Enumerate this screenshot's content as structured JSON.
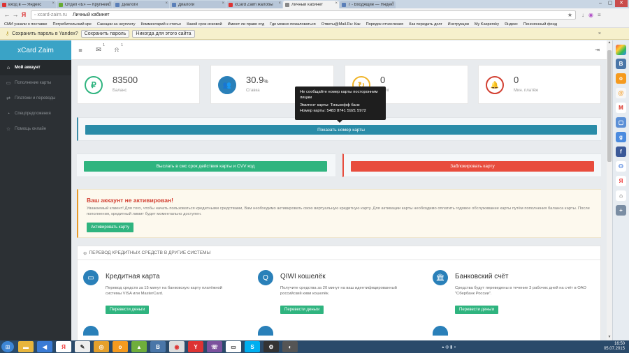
{
  "browser": {
    "tabs": [
      {
        "label": "вход в — Яндекс",
        "icon": "red"
      },
      {
        "label": "Отдел «Б» — Крупнейший",
        "icon": "green"
      },
      {
        "label": "Диалоги",
        "icon": "blue"
      },
      {
        "label": "Диалоги",
        "icon": "blue"
      },
      {
        "label": "xCard Zaim жалобы",
        "icon": "red"
      },
      {
        "label": "Личный кабинет",
        "icon": "gray",
        "active": true
      },
      {
        "label": "7 - Входящие — Яндекс",
        "icon": "blue"
      }
    ],
    "url_domain": "xcard-zaim.ru",
    "url_title": "Личный кабинет",
    "bookmarks": [
      "СМИ узнали о поставке",
      "Потребительский кре",
      "Санкции за неуплату",
      "Комментарий к статье",
      "Какой срок исковой",
      "Имеют ли право отд",
      "Где можно пожаловаться",
      "Ответы@Mail.Ru: Как",
      "Порядок отчисления",
      "Как передать долг",
      "Инструкции",
      "My Kaspersky",
      "Яндекс",
      "Пенсионный фонд"
    ],
    "password_bar": {
      "text": "Сохранить пароль в Yandex?",
      "save": "Сохранить пароль",
      "never": "Никогда для этого сайта"
    }
  },
  "app": {
    "logo": "xCard Zaim",
    "sidebar": [
      {
        "label": "Мой аккаунт",
        "icon": "home-icon",
        "glyph": "⌂",
        "active": true
      },
      {
        "label": "Пополнение карты",
        "icon": "card-icon",
        "glyph": "▭"
      },
      {
        "label": "Платежи и переводы",
        "icon": "transfer-icon",
        "glyph": "⇄"
      },
      {
        "label": "Спецпредложения",
        "icon": "offers-icon",
        "glyph": "◔"
      },
      {
        "label": "Помощь онлайн",
        "icon": "help-icon",
        "glyph": "☆"
      }
    ],
    "header": {
      "mail_count": "1",
      "bell_count": "1"
    },
    "stats": [
      {
        "value": "83500",
        "unit": "",
        "label": "Баланс",
        "glyph": "₽",
        "color": "#2fb47f"
      },
      {
        "value": "30.9",
        "unit": "%",
        "label": "Ставка",
        "glyph": "👥",
        "color": "#2a80b9"
      },
      {
        "value": "0",
        "unit": "",
        "label": "Долг",
        "glyph": "↻",
        "color": "#f0b429"
      },
      {
        "value": "0",
        "unit": "",
        "label": "Мин. платёж",
        "glyph": "🔔",
        "color": "#d23f31"
      }
    ],
    "show_card_button": "Показать номер карты",
    "tooltip": {
      "line1": "Не сообщайте номер карты посторонним лицам",
      "issuer": "Эмитент карты: Тинькофф банк",
      "number": "Номер карты: 5483 8741 5921 5972"
    },
    "send_cvv_button": "Выслать в смс срок действия карты и CVV код",
    "block_card_button": "Заблокировать карту",
    "warning": {
      "title": "Ваш аккаунт не активирован!",
      "text": "Уважаемый клиент! Для того, чтобы начать пользоваться кредитными средствами, Вам необходимо активировать свою виртуальную кредитную карту. Для активации карты необходимо оплатить годовое обслуживание карты путём пополнения баланса карты. После пополнения, кредитный лимит будет моментально доступен.",
      "button": "Активировать карту"
    },
    "transfer": {
      "title": "ПЕРЕВОД КРЕДИТНЫХ СРЕДСТВ В ДРУГИЕ СИСТЕМЫ",
      "services": [
        {
          "title": "Кредитная карта",
          "glyph": "▭",
          "desc": "Перевод средств за 15 минут на банковскую карту платёжной системы VISA или MasterCard.",
          "button": "Перевести деньги"
        },
        {
          "title": "QIWI кошелёк",
          "glyph": "Q",
          "desc": "Получите средства за 20 минут на ваш идентифицированный российский киви кошелёк.",
          "button": "Перевести деньги"
        },
        {
          "title": "Банковский счёт",
          "glyph": "🏛",
          "desc": "Средства будут переведены в течение 3 рабочих дней на счёт в ОАО \"Сбербанк России\".",
          "button": "Перевести деньги"
        }
      ]
    }
  },
  "taskbar": {
    "time": "16:50",
    "date": "05.07.2015"
  },
  "colors": {
    "accent": "#3aa3c6",
    "sidebar_bg": "#2c3034",
    "primary_btn": "#2a8ca8",
    "green_btn": "#2fb47f",
    "red_btn": "#e84c3d"
  }
}
